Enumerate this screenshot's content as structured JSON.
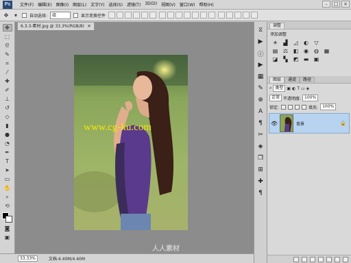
{
  "app": {
    "logo": "Ps",
    "menu": [
      "文件(F)",
      "编辑(E)",
      "图像(I)",
      "图层(L)",
      "文字(Y)",
      "选择(S)",
      "滤镜(T)",
      "3D(D)",
      "视图(V)",
      "窗口(W)",
      "帮助(H)"
    ],
    "window_buttons": [
      "–",
      "□",
      "×"
    ]
  },
  "options_bar": {
    "auto_select_label": "自动选择:",
    "auto_select_value": "组",
    "show_transform_label": "显示变换控件"
  },
  "document": {
    "tab_title": "6.3.3-素材.jpg @ 33.3%(RGB/8)",
    "tab_close": "×",
    "watermark": "www.cg-ku.com",
    "corner_watermark": "人人素材"
  },
  "status": {
    "zoom": "33.33%",
    "doc_size": "文档:4.40M/4.40M"
  },
  "adjustments": {
    "tab": "调整",
    "title": "添加调整"
  },
  "layers": {
    "tabs": [
      "图层",
      "通道",
      "路径"
    ],
    "kind_label": "类型",
    "blend_mode": "正常",
    "opacity_label": "不透明度:",
    "opacity_value": "100%",
    "lock_label": "锁定:",
    "fill_label": "填充:",
    "fill_value": "100%",
    "items": [
      {
        "name": "背景",
        "visible": true,
        "locked": true
      }
    ]
  },
  "colors": {
    "accent": "#b7d3ef",
    "watermark": "#f5e600",
    "ps_logo_bg": "#2b4a73"
  }
}
